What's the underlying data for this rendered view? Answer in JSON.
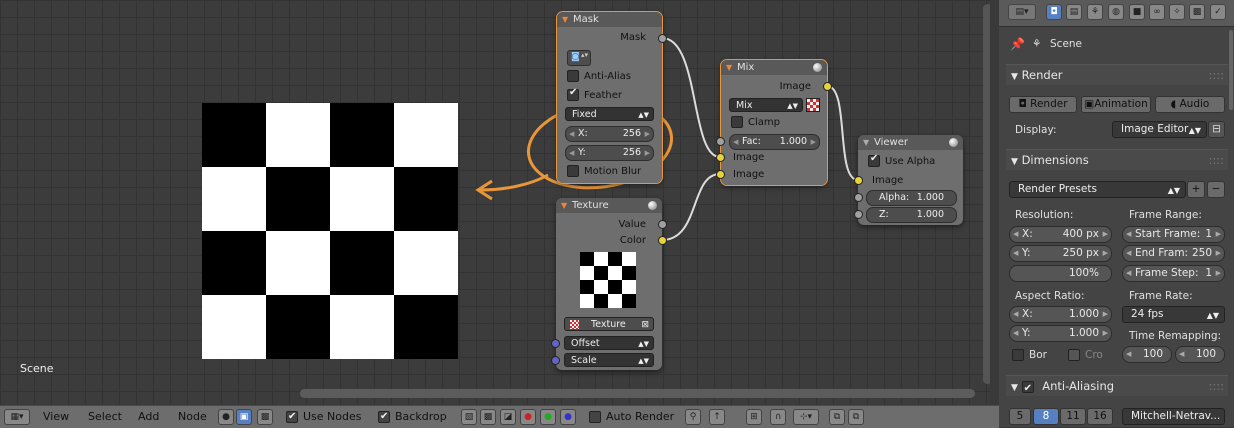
{
  "editor": {
    "scene_label": "Scene",
    "nodes": {
      "mask": {
        "title": "Mask",
        "output": "Mask",
        "anti_alias": "Anti-Alias",
        "feather": "Feather",
        "fixed": "Fixed",
        "x_label": "X:",
        "x_value": "256",
        "y_label": "Y:",
        "y_value": "256",
        "motion_blur": "Motion Blur"
      },
      "mix": {
        "title": "Mix",
        "output": "Image",
        "mode": "Mix",
        "clamp": "Clamp",
        "fac_label": "Fac:",
        "fac_value": "1.000",
        "input1": "Image",
        "input2": "Image"
      },
      "viewer": {
        "title": "Viewer",
        "use_alpha": "Use Alpha",
        "input_image": "Image",
        "alpha_label": "Alpha:",
        "alpha_value": "1.000",
        "z_label": "Z:",
        "z_value": "1.000"
      },
      "texture": {
        "title": "Texture",
        "value": "Value",
        "color": "Color",
        "texture_name": "Texture",
        "offset": "Offset",
        "scale": "Scale"
      }
    }
  },
  "bottombar": {
    "view": "View",
    "select": "Select",
    "add": "Add",
    "node": "Node",
    "use_nodes": "Use Nodes",
    "backdrop": "Backdrop",
    "auto_render": "Auto Render"
  },
  "properties": {
    "scene": "Scene",
    "render_panel": {
      "title": "Render",
      "render_btn": "Render",
      "animation_btn": "Animation",
      "audio_btn": "Audio",
      "display_label": "Display:",
      "display_value": "Image Editor"
    },
    "dimensions_panel": {
      "title": "Dimensions",
      "presets": "Render Presets",
      "resolution_label": "Resolution:",
      "res_x_label": "X:",
      "res_x_value": "400 px",
      "res_y_label": "Y:",
      "res_y_value": "250 px",
      "res_pct": "100%",
      "frame_range_label": "Frame Range:",
      "start_label": "Start Frame:",
      "start_value": "1",
      "end_label": "End Fram:",
      "end_value": "250",
      "step_label": "Frame Step:",
      "step_value": "1",
      "aspect_label": "Aspect Ratio:",
      "asp_x_label": "X:",
      "asp_x_value": "1.000",
      "asp_y_label": "Y:",
      "asp_y_value": "1.000",
      "frame_rate_label": "Frame Rate:",
      "frame_rate_value": "24 fps",
      "time_remap_label": "Time Remapping:",
      "remap_old": "100",
      "remap_new": "100",
      "border": "Bor",
      "crop": "Cro"
    },
    "aa_panel": {
      "title": "Anti-Aliasing",
      "samples": [
        "5",
        "8",
        "11",
        "16"
      ],
      "filter": "Mitchell-Netrav..."
    }
  },
  "colors": {
    "annotation": "#e8963a",
    "selected_sample": "#5680c2",
    "socket_image": "#e6d23c",
    "socket_value": "#a0a0a0",
    "socket_vector": "#6363c7"
  }
}
